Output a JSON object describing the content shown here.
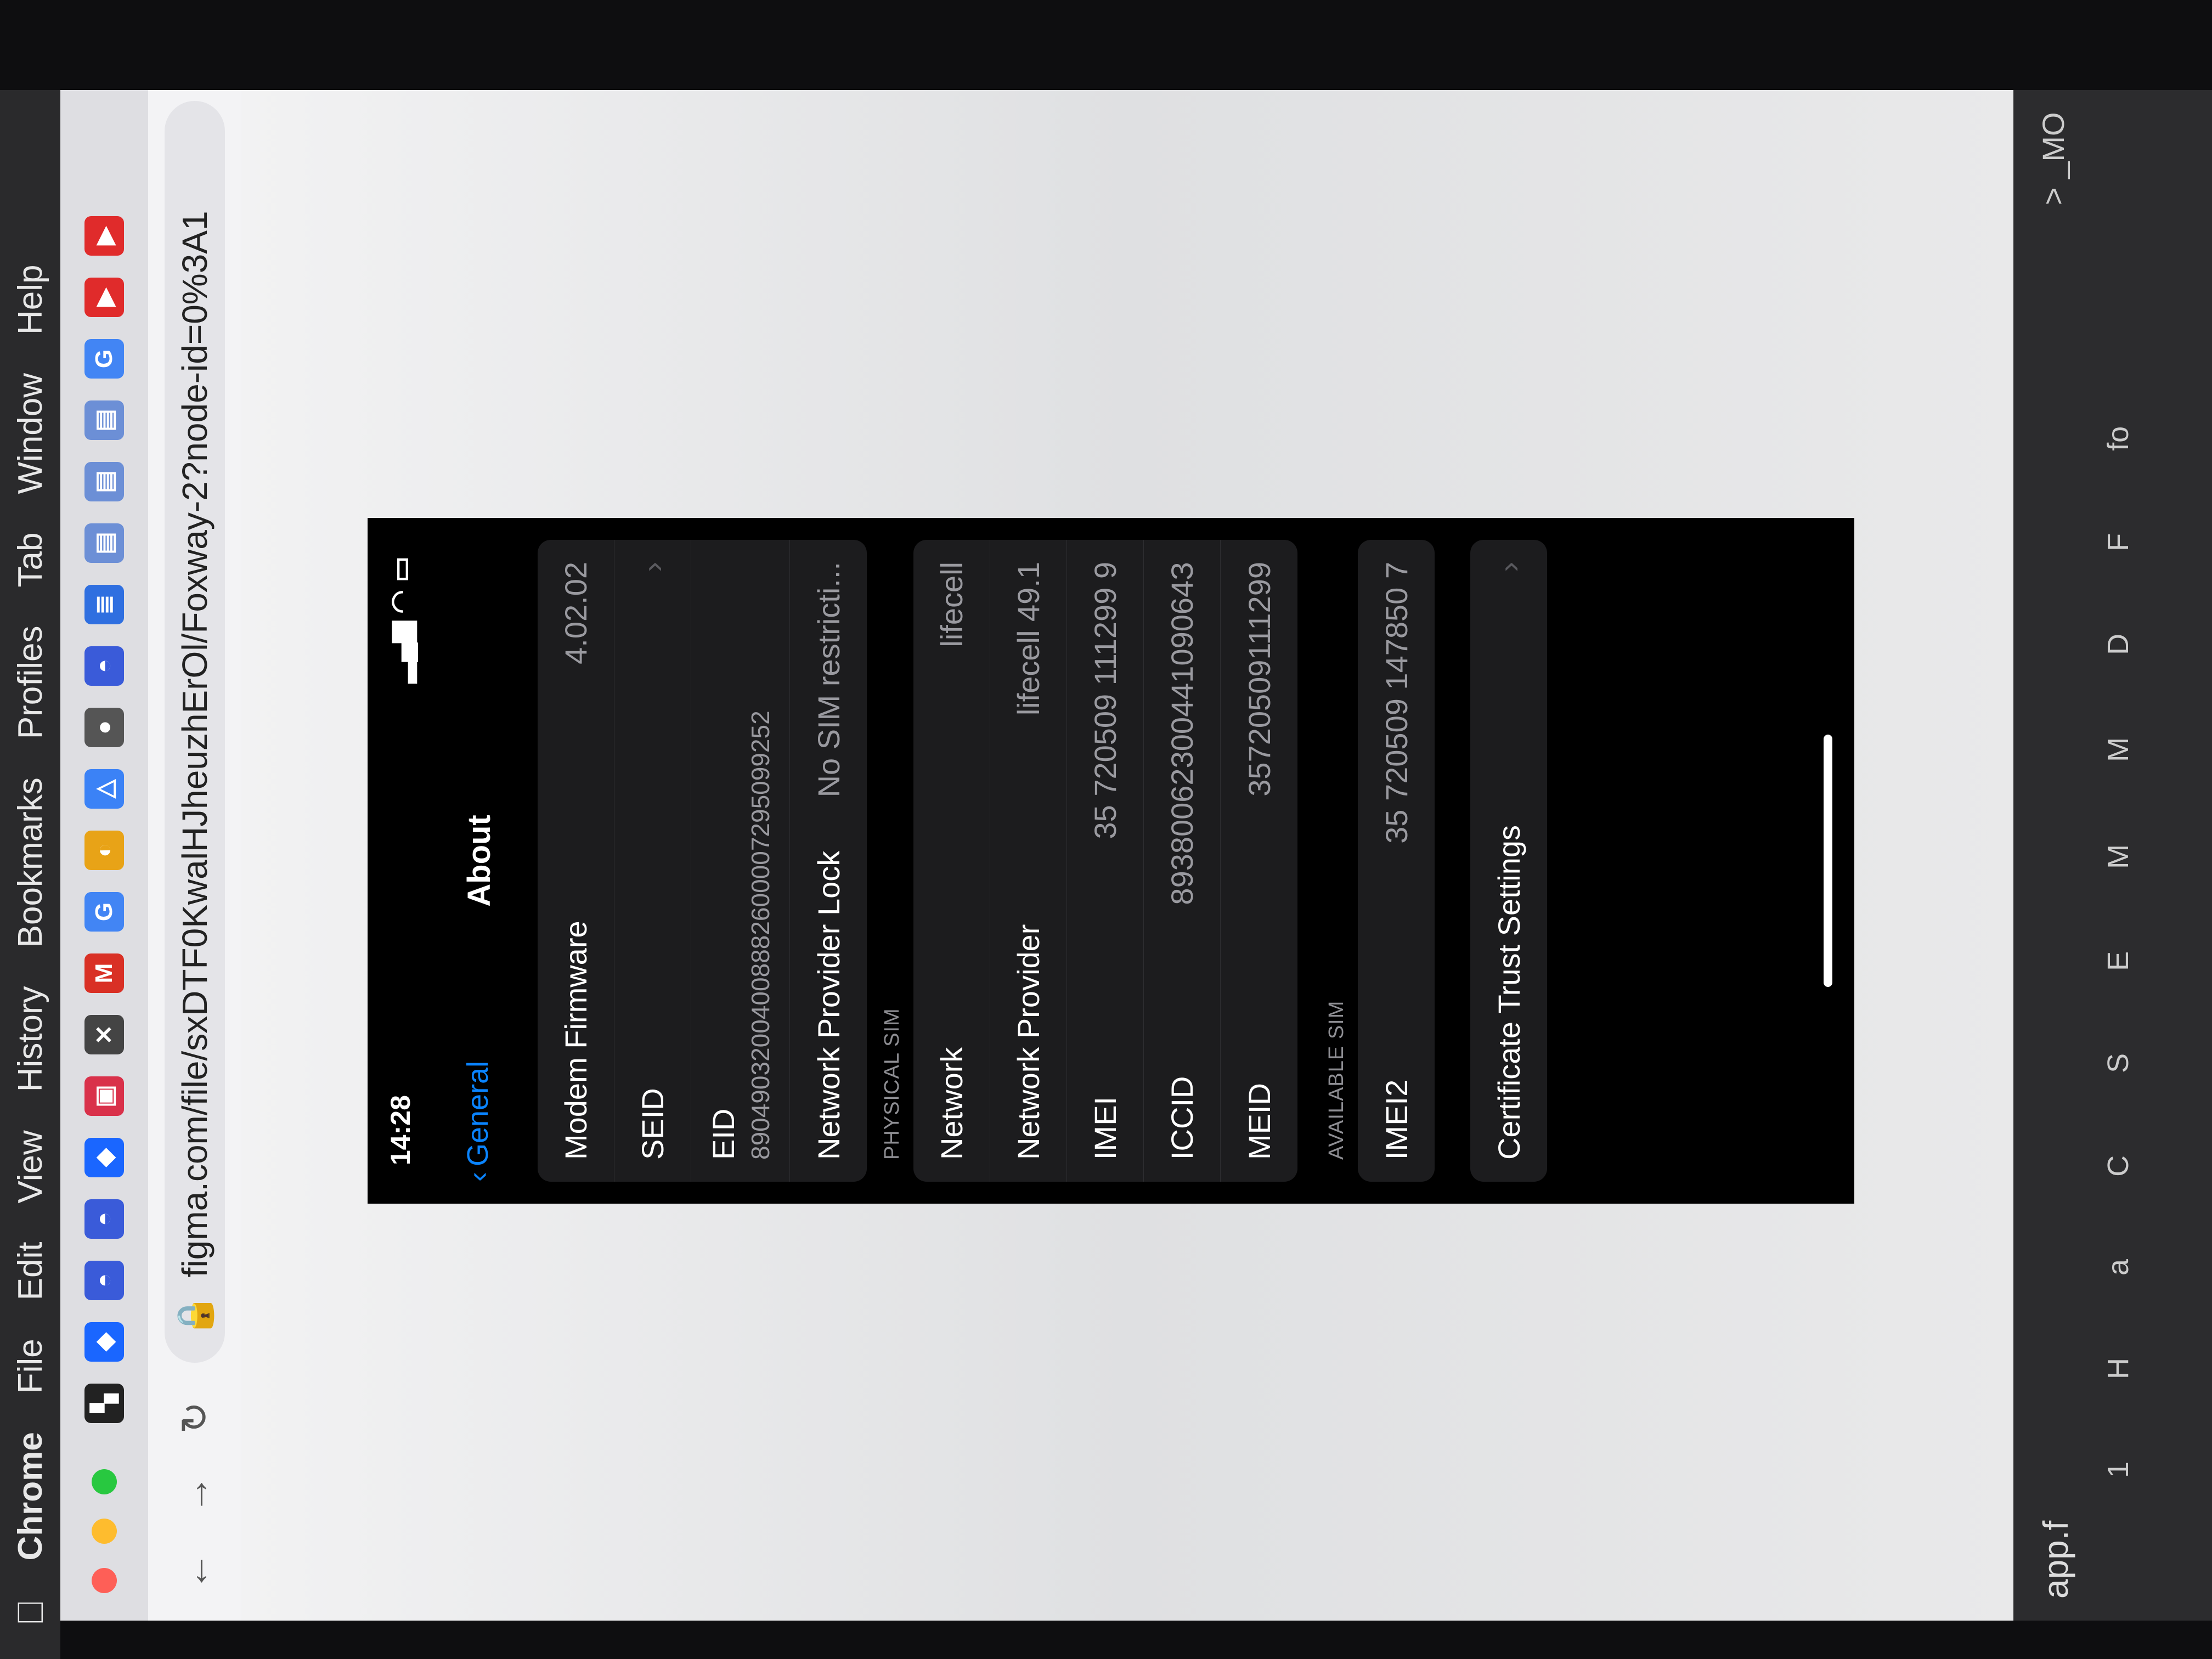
{
  "menubar": {
    "apple": "",
    "app": "Chrome",
    "items": [
      "File",
      "Edit",
      "View",
      "History",
      "Bookmarks",
      "Profiles",
      "Tab",
      "Window",
      "Help"
    ]
  },
  "tabs": [
    {
      "icon": "figma-icon",
      "glyph": "▚",
      "color": "#222"
    },
    {
      "icon": "diamond-icon",
      "glyph": "◆",
      "color": "#1a66ff"
    },
    {
      "icon": "github-icon",
      "glyph": "◓",
      "color": "#3a5bd9"
    },
    {
      "icon": "github-icon",
      "glyph": "◓",
      "color": "#3a5bd9"
    },
    {
      "icon": "diamond-icon",
      "glyph": "◆",
      "color": "#1a66ff"
    },
    {
      "icon": "trello-icon",
      "glyph": "▣",
      "color": "#d9314a"
    },
    {
      "icon": "close-icon",
      "glyph": "✕",
      "color": "#444"
    },
    {
      "icon": "gmail-icon",
      "glyph": "M",
      "color": "#d93025"
    },
    {
      "icon": "google-icon",
      "glyph": "G",
      "color": "#4285f4"
    },
    {
      "icon": "slack-icon",
      "glyph": "◐",
      "color": "#e8a317"
    },
    {
      "icon": "drive-icon",
      "glyph": "△",
      "color": "#3b82f6"
    },
    {
      "icon": "apple-icon",
      "glyph": "●",
      "color": "#555"
    },
    {
      "icon": "github-icon",
      "glyph": "◓",
      "color": "#3a5bd9"
    },
    {
      "icon": "docs-icon",
      "glyph": "≣",
      "color": "#2f6fe0"
    },
    {
      "icon": "doc-icon",
      "glyph": "▤",
      "color": "#6c8fd6"
    },
    {
      "icon": "doc-icon",
      "glyph": "▤",
      "color": "#6c8fd6"
    },
    {
      "icon": "doc-icon",
      "glyph": "▤",
      "color": "#6c8fd6"
    },
    {
      "icon": "google-icon",
      "glyph": "G",
      "color": "#4285f4"
    },
    {
      "icon": "youtube-icon",
      "glyph": "▶",
      "color": "#e02b2b"
    },
    {
      "icon": "youtube-icon",
      "glyph": "▶",
      "color": "#e02b2b"
    }
  ],
  "address": {
    "url": "figma.com/file/sxDTF0KwalHJheuzhErOl/Foxway-2?node-id=0%3A1"
  },
  "phone": {
    "time": "14:28",
    "back_label": "General",
    "title": "About",
    "group1": [
      {
        "label": "Modem Firmware",
        "value": "4.02.02"
      },
      {
        "label": "SEID",
        "value": ""
      }
    ],
    "eid_label": "EID",
    "eid_value": "89049032004008882600007295099252",
    "network_lock_label": "Network Provider Lock",
    "network_lock_value": "No SIM restricti...",
    "physical_sim_header": "PHYSICAL SIM",
    "group2": [
      {
        "label": "Network",
        "value": "lifecell"
      },
      {
        "label": "Network Provider",
        "value": "lifecell 49.1"
      },
      {
        "label": "IMEI",
        "value": "35 720509 111299 9"
      },
      {
        "label": "ICCID",
        "value": "8938006230044109064З"
      },
      {
        "label": "MEID",
        "value": "35720509111299"
      }
    ],
    "available_sim_header": "AVAILABLE SIM",
    "imei2_label": "IMEI2",
    "imei2_value": "35 720509 147850 7",
    "cert_label": "Certificate Trust Settings"
  },
  "figma_sidebar": {
    "url_fragment": "app.f",
    "items": [
      "1",
      "H",
      "a",
      "C",
      "S",
      "E",
      "M",
      "M",
      "D",
      "F",
      "fo"
    ],
    "bottom": "> _MO"
  }
}
